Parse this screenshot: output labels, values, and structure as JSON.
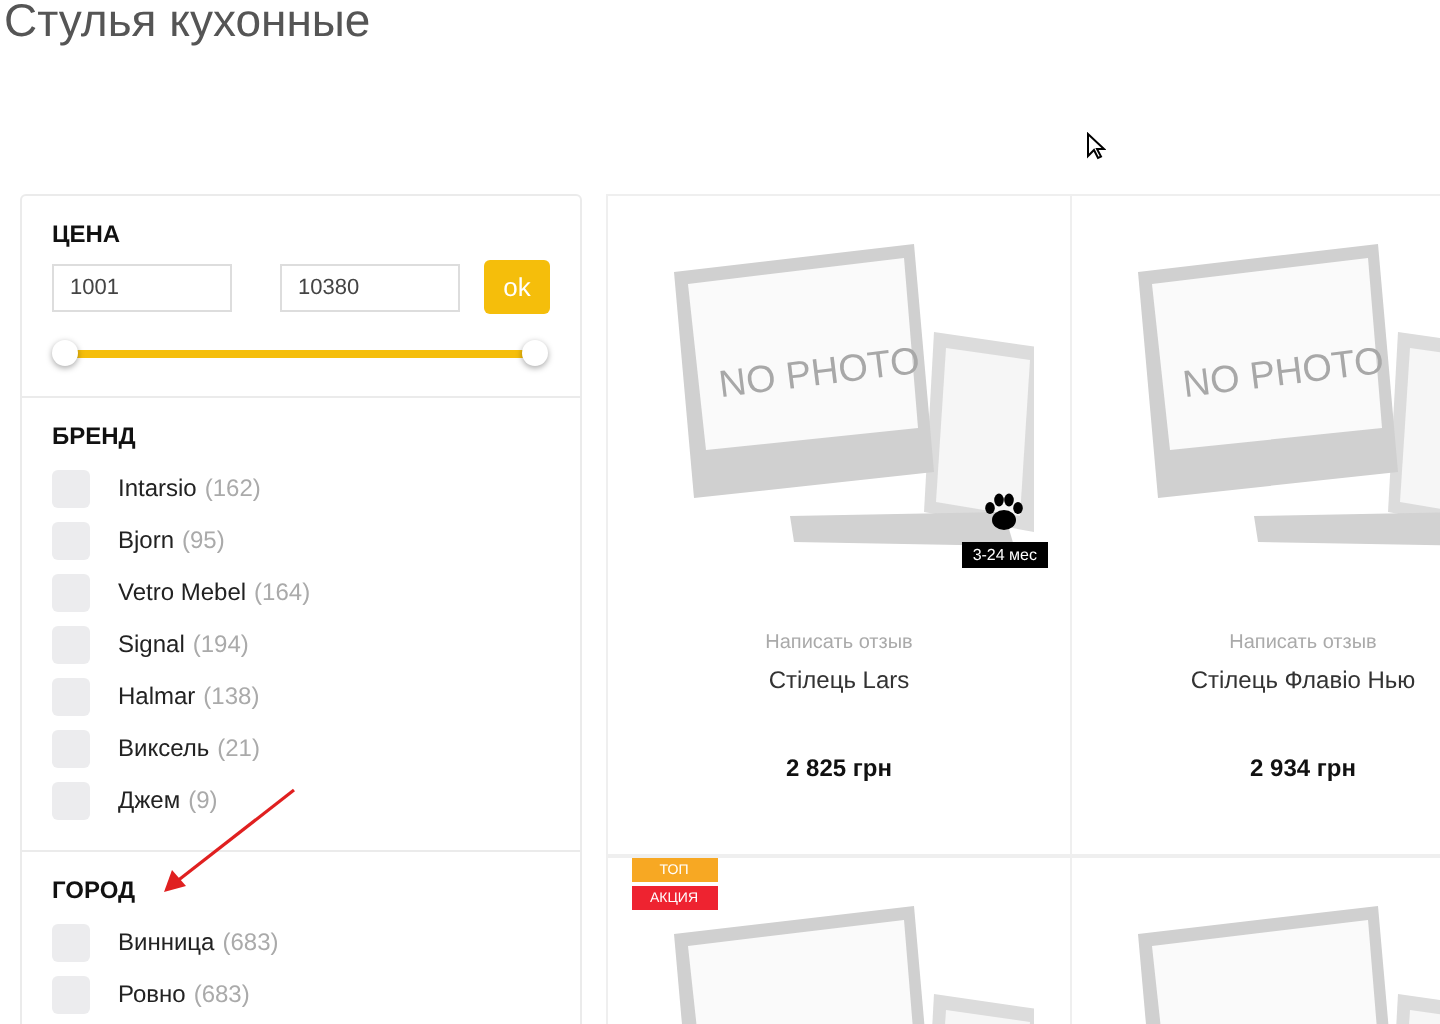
{
  "page_title": "Стулья кухонные",
  "filters": {
    "price": {
      "title": "ЦЕНА",
      "min": "1001",
      "max": "10380",
      "button": "ok",
      "level": 1
    },
    "groups": [
      {
        "title": "БРЕНД",
        "items": [
          {
            "label": "Intarsio",
            "count": "(162)",
            "checked": false
          },
          {
            "label": "Bjorn",
            "count": "(95)",
            "checked": false
          },
          {
            "label": "Vetro Mebel",
            "count": "(164)",
            "checked": false
          },
          {
            "label": "Signal",
            "count": "(194)",
            "checked": false
          },
          {
            "label": "Halmar",
            "count": "(138)",
            "checked": false
          },
          {
            "label": "Виксель",
            "count": "(21)",
            "checked": false
          },
          {
            "label": "Джем",
            "count": "(9)",
            "checked": false
          }
        ]
      },
      {
        "title": "ГОРОД",
        "items": [
          {
            "label": "Винница",
            "count": "(683)",
            "checked": false
          },
          {
            "label": "Ровно",
            "count": "(683)",
            "checked": false
          }
        ]
      }
    ]
  },
  "products": [
    {
      "kind": "no_photo",
      "image_text": "NO PHOTO",
      "age_badge": "3-24 мес",
      "pet_friendly": true,
      "review_link": "Написать отзыв",
      "name": "Стілець Lars",
      "price": "2 825 грн"
    },
    {
      "kind": "no_photo",
      "image_text": "NO PHOTO",
      "review_link": "Написать отзыв",
      "name": "Стілець Флавіо Нью",
      "price": "2 934 грн"
    },
    {
      "kind": "no_photo",
      "tags": [
        {
          "text": "ТОП",
          "color": "#f7a823"
        },
        {
          "text": "АКЦИЯ",
          "color": "#ee2330"
        }
      ]
    },
    {
      "kind": "no_photo"
    }
  ]
}
